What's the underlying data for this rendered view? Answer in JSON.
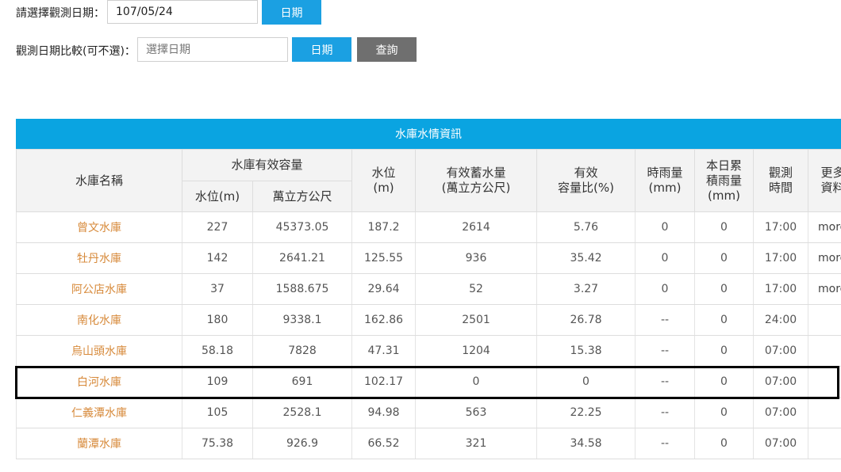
{
  "form": {
    "date_label": "請選擇觀測日期：",
    "date_value": "107/05/24",
    "date_button": "日期",
    "compare_label": "觀測日期比較(可不選)：",
    "compare_placeholder": "選擇日期",
    "compare_button": "日期",
    "query_button": "查詢"
  },
  "table": {
    "banner": "水庫水情資訊",
    "headers": {
      "name": "水庫名稱",
      "capacity_group": "水庫有效容量",
      "cap_level": "水位(m)",
      "cap_volume": "萬立方公尺",
      "level_line1": "水位",
      "level_line2": "(m)",
      "storage_line1": "有效蓄水量",
      "storage_line2": "(萬立方公尺)",
      "ratio_line1": "有效",
      "ratio_line2": "容量比(%)",
      "hourly_line1": "時雨量",
      "hourly_line2": "(mm)",
      "daily_line1": "本日累",
      "daily_line2": "積雨量",
      "daily_line3": "(mm)",
      "time_line1": "觀測",
      "time_line2": "時間",
      "more_line1": "更多",
      "more_line2": "資料"
    },
    "rows": [
      {
        "name": "曾文水庫",
        "cap_level": "227",
        "cap_volume": "45373.05",
        "level": "187.2",
        "storage": "2614",
        "ratio": "5.76",
        "hourly": "0",
        "daily": "0",
        "time": "17:00",
        "more": "more"
      },
      {
        "name": "牡丹水庫",
        "cap_level": "142",
        "cap_volume": "2641.21",
        "level": "125.55",
        "storage": "936",
        "ratio": "35.42",
        "hourly": "0",
        "daily": "0",
        "time": "17:00",
        "more": "more"
      },
      {
        "name": "阿公店水庫",
        "cap_level": "37",
        "cap_volume": "1588.675",
        "level": "29.64",
        "storage": "52",
        "ratio": "3.27",
        "hourly": "0",
        "daily": "0",
        "time": "17:00",
        "more": "more"
      },
      {
        "name": "南化水庫",
        "cap_level": "180",
        "cap_volume": "9338.1",
        "level": "162.86",
        "storage": "2501",
        "ratio": "26.78",
        "hourly": "--",
        "daily": "0",
        "time": "24:00",
        "more": ""
      },
      {
        "name": "烏山頭水庫",
        "cap_level": "58.18",
        "cap_volume": "7828",
        "level": "47.31",
        "storage": "1204",
        "ratio": "15.38",
        "hourly": "--",
        "daily": "0",
        "time": "07:00",
        "more": ""
      },
      {
        "name": "白河水庫",
        "cap_level": "109",
        "cap_volume": "691",
        "level": "102.17",
        "storage": "0",
        "ratio": "0",
        "hourly": "--",
        "daily": "0",
        "time": "07:00",
        "more": ""
      },
      {
        "name": "仁義潭水庫",
        "cap_level": "105",
        "cap_volume": "2528.1",
        "level": "94.98",
        "storage": "563",
        "ratio": "22.25",
        "hourly": "--",
        "daily": "0",
        "time": "07:00",
        "more": ""
      },
      {
        "name": "蘭潭水庫",
        "cap_level": "75.38",
        "cap_volume": "926.9",
        "level": "66.52",
        "storage": "321",
        "ratio": "34.58",
        "hourly": "--",
        "daily": "0",
        "time": "07:00",
        "more": ""
      }
    ]
  }
}
